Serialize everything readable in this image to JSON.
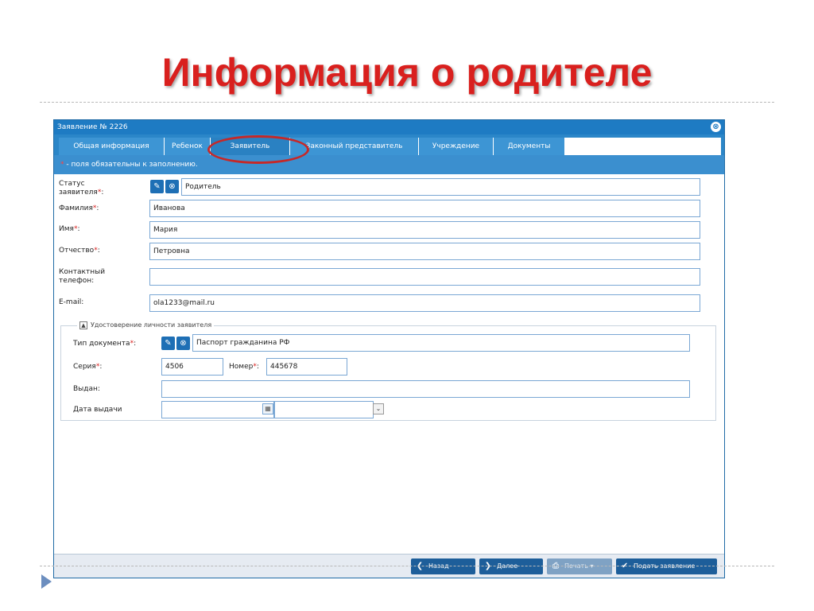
{
  "slide": {
    "title": "Информация о родителе"
  },
  "window": {
    "title": "Заявление № 2226",
    "close_icon": "⊗"
  },
  "tabs": [
    {
      "label": "Общая информация"
    },
    {
      "label": "Ребенок"
    },
    {
      "label": "Заявитель"
    },
    {
      "label": "Законный представитель"
    },
    {
      "label": "Учреждение"
    },
    {
      "label": "Документы"
    }
  ],
  "notice": {
    "star": "*",
    "text": " - поля обязательны к заполнению."
  },
  "form": {
    "status": {
      "label_line1": "Статус",
      "label_line2": "заявителя",
      "req": "*",
      "colon": ":",
      "value": "Родитель"
    },
    "surname": {
      "label": "Фамилия",
      "req": "*",
      "colon": ":",
      "value": "Иванова"
    },
    "name": {
      "label": "Имя",
      "req": "*",
      "colon": ":",
      "value": "Мария"
    },
    "patronymic": {
      "label": "Отчество",
      "req": "*",
      "colon": ":",
      "value": "Петровна"
    },
    "phone": {
      "label_line1": "Контактный",
      "label_line2": "телефон:",
      "value": ""
    },
    "email": {
      "label": "E-mail:",
      "value": "ola1233@mail.ru"
    }
  },
  "identity": {
    "legend": "Удостоверение личности заявителя",
    "toggle": "▲",
    "doc_type": {
      "label": "Тип документа",
      "req": "*",
      "colon": ":",
      "value": "Паспорт гражданина РФ"
    },
    "series": {
      "label": "Серия",
      "req": "*",
      "colon": ":",
      "value": "4506"
    },
    "number": {
      "label": "Номер",
      "req": "*",
      "colon": ":",
      "value": "445678"
    },
    "issued_by": {
      "label": "Выдан:",
      "value": ""
    },
    "issue_date": {
      "label": "Дата выдачи",
      "date_value": "",
      "time_value": ""
    }
  },
  "footer": {
    "back": "Назад",
    "next": "Далее",
    "print": "Печать",
    "submit": "Подать заявление"
  },
  "colors": {
    "title_red": "#d9201e",
    "window_blue": "#1e7bc3",
    "highlight": "#c62828"
  }
}
